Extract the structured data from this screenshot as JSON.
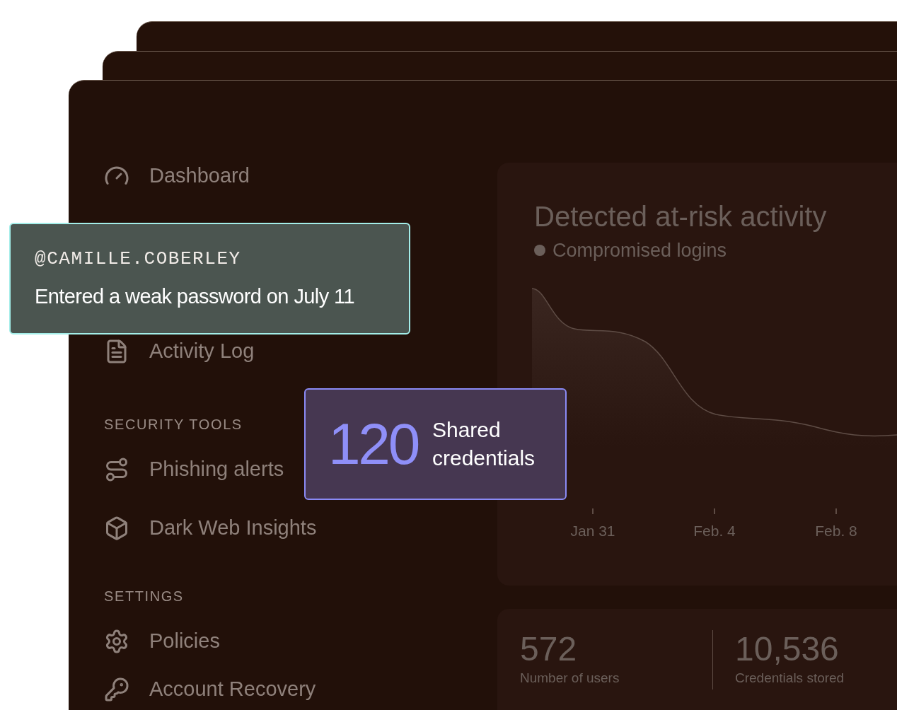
{
  "sidebar": {
    "sections": [
      {
        "items": [
          {
            "label": "Dashboard"
          },
          {
            "label": "Activity Log"
          }
        ]
      },
      {
        "heading": "SECURITY TOOLS",
        "items": [
          {
            "label": "Phishing alerts"
          },
          {
            "label": "Dark Web Insights"
          }
        ]
      },
      {
        "heading": "SETTINGS",
        "items": [
          {
            "label": "Policies"
          },
          {
            "label": "Account Recovery"
          }
        ]
      }
    ]
  },
  "chart_card": {
    "title": "Detected at-risk activity",
    "legend": "Compromised logins",
    "x_labels": [
      "Jan 31",
      "Feb. 4",
      "Feb. 8"
    ]
  },
  "stats": [
    {
      "value": "572",
      "label": "Number of users"
    },
    {
      "value": "10,536",
      "label": "Credentials stored"
    }
  ],
  "alert_popup": {
    "user": "@CAMILLE.COBERLEY",
    "message": "Entered a weak password on July 11"
  },
  "shared_popup": {
    "count": "120",
    "label": "Shared credentials"
  }
}
